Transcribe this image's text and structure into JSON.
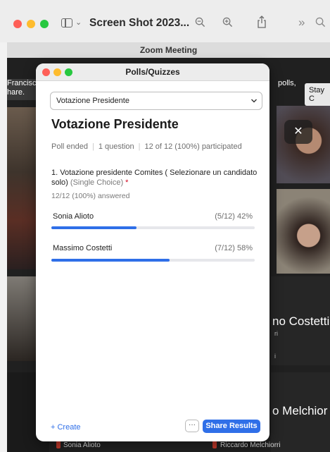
{
  "preview": {
    "title": "Screen Shot 2023..."
  },
  "zoom": {
    "window_title": "Zoom Meeting",
    "banner_left": "Francisco\nhare.",
    "banner_right_text": "polls,",
    "banner_button": "Stay C",
    "tile_names": {
      "costetti": "no Costetti",
      "melchior": "o Melchior",
      "small_ri": "ri",
      "small_i": "i"
    },
    "bottom_names": {
      "left": "Sonia Alioto",
      "right": "Riccardo Melchiorri"
    }
  },
  "polls": {
    "window_title": "Polls/Quizzes",
    "selected_poll": "Votazione Presidente",
    "heading": "Votazione Presidente",
    "meta": {
      "status": "Poll ended",
      "questions": "1 question",
      "participation": "12 of 12 (100%) participated"
    },
    "question": {
      "text": "1. Votazione presidente Comites ( Selezionare un candidato solo)",
      "type": "(Single Choice)",
      "required_mark": "*",
      "answered": "12/12 (100%) answered"
    },
    "options": [
      {
        "label": "Sonia Alioto",
        "count": "(5/12) 42%",
        "fraction": 0.42
      },
      {
        "label": "Massimo Costetti",
        "count": "(7/12) 58%",
        "fraction": 0.58
      }
    ],
    "footer": {
      "create_label": "+ Create",
      "more_label": "···",
      "share_label": "Share Results"
    },
    "accent_color": "#2f6fe8"
  }
}
